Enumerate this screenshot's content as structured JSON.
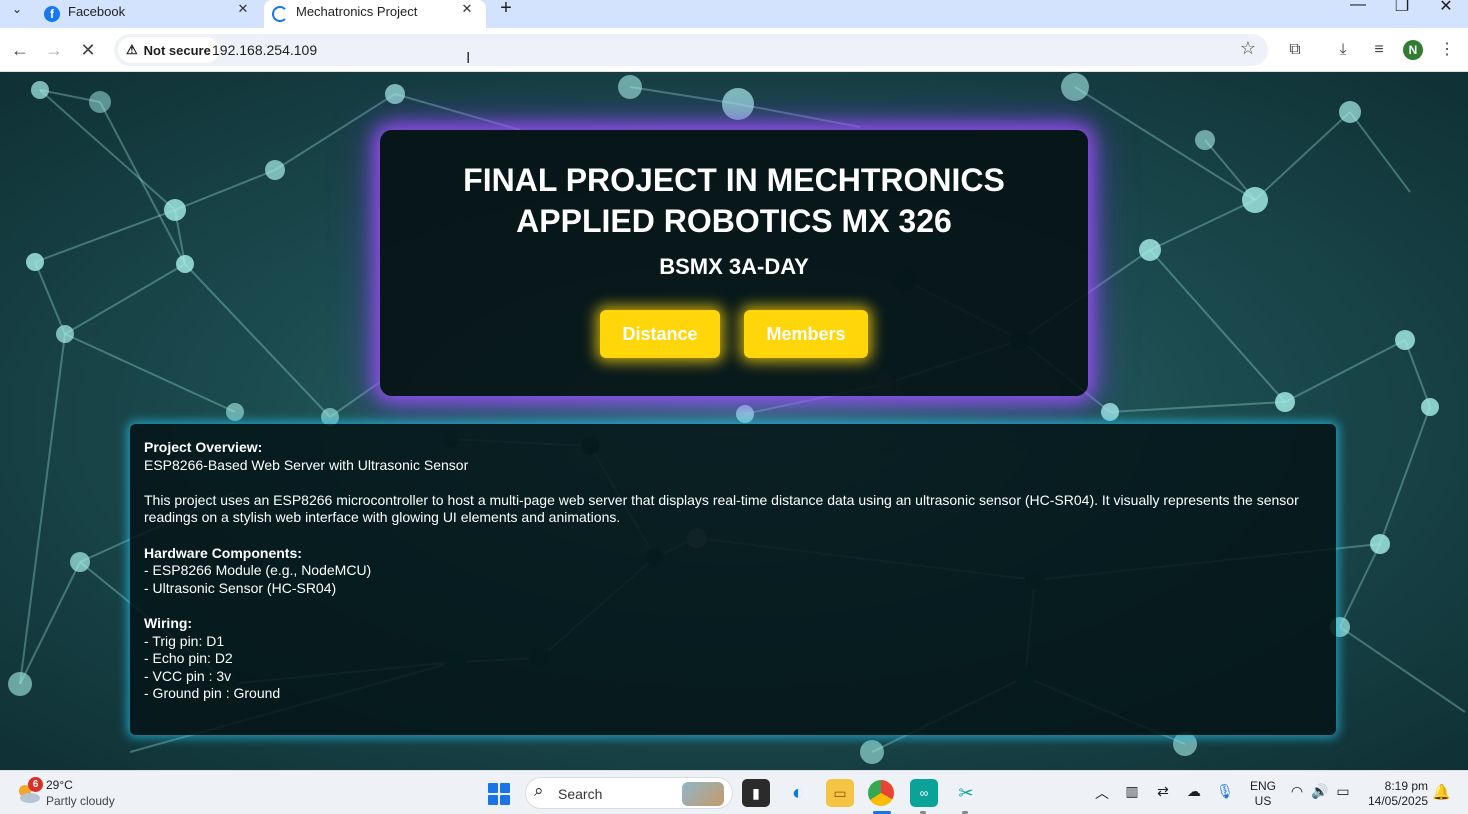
{
  "browser": {
    "tabs": [
      {
        "title": "Facebook",
        "favicon": "facebook-icon",
        "active": false
      },
      {
        "title": "Mechatronics Project",
        "favicon": "loading-spinner-icon",
        "active": true
      }
    ],
    "security_label": "Not secure",
    "url": "192.168.254.109",
    "profile_initial": "N",
    "profile_color": "#2e7d32"
  },
  "page": {
    "title": "FINAL PROJECT IN MECHTRONICS APPLIED ROBOTICS MX 326",
    "subtitle": "BSMX 3A-DAY",
    "buttons": {
      "distance": "Distance",
      "members": "Members"
    },
    "button_color": "#ffd60a",
    "hero_glow_color": "#a050ff",
    "overview_glow_color": "#28bee6",
    "overview": {
      "heading": "Project Overview:",
      "summary": "ESP8266-Based Web Server with Ultrasonic Sensor",
      "description": "This project uses an ESP8266 microcontroller to host a multi-page web server that displays real-time distance data using an ultrasonic sensor (HC-SR04). It visually represents the sensor readings on a stylish web interface with glowing UI elements and animations.",
      "hardware_heading": "Hardware Components:",
      "hardware": [
        "- ESP8266 Module (e.g., NodeMCU)",
        "- Ultrasonic Sensor (HC-SR04)"
      ],
      "wiring_heading": "Wiring:",
      "wiring": [
        "- Trig pin: D1",
        "- Echo pin: D2",
        "- VCC pin : 3v",
        "- Ground pin : Ground"
      ]
    }
  },
  "taskbar": {
    "weather": {
      "badge": "6",
      "temperature": "29°C",
      "condition": "Partly cloudy"
    },
    "search_label": "Search",
    "language": {
      "line1": "ENG",
      "line2": "US"
    },
    "clock": {
      "time": "8:19 pm",
      "date": "14/05/2025"
    }
  }
}
